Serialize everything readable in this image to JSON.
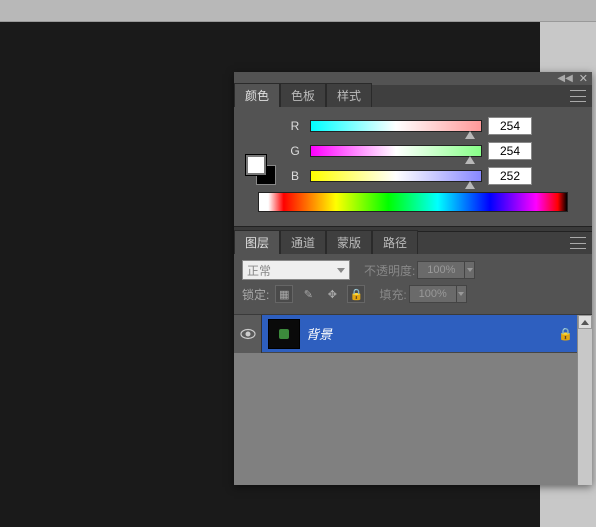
{
  "color_panel": {
    "tabs": [
      "颜色",
      "色板",
      "样式"
    ],
    "active_tab": 0,
    "channels": {
      "r": {
        "label": "R",
        "value": "254"
      },
      "g": {
        "label": "G",
        "value": "254"
      },
      "b": {
        "label": "B",
        "value": "252"
      }
    }
  },
  "layers_panel": {
    "tabs": [
      "图层",
      "通道",
      "蒙版",
      "路径"
    ],
    "active_tab": 0,
    "blend_mode": "正常",
    "opacity_label": "不透明度:",
    "opacity_value": "100%",
    "lock_label": "锁定:",
    "fill_label": "填充:",
    "fill_value": "100%",
    "layers": [
      {
        "name": "背景",
        "visible": true,
        "locked": true
      }
    ]
  }
}
